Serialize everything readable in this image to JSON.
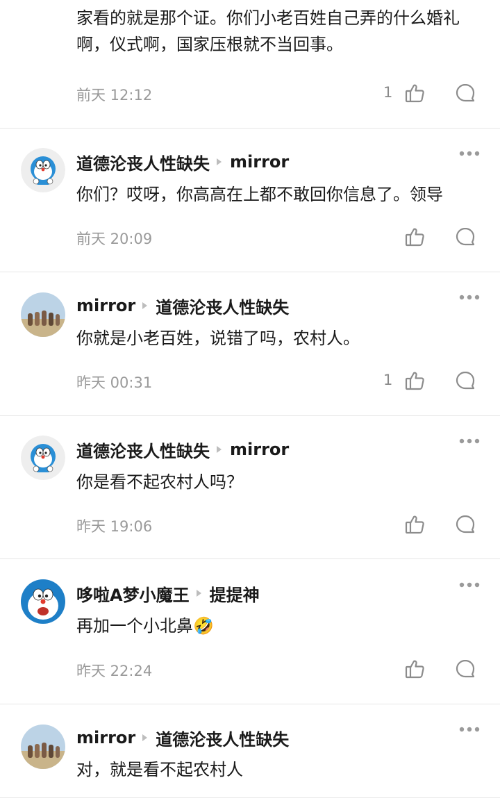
{
  "comments": [
    {
      "text": "家看的就是那个证。你们小老百姓自己弄的什么婚礼啊，仪式啊，国家压根就不当回事。",
      "time": "前天 12:12",
      "likes": "1"
    },
    {
      "author": "道德沦丧人性缺失",
      "reply_to": "mirror",
      "text": "你们？哎呀，你高高在上都不敢回你信息了。领导",
      "time": "前天 20:09",
      "likes": ""
    },
    {
      "author": "mirror",
      "reply_to": "道德沦丧人性缺失",
      "text": "你就是小老百姓，说错了吗，农村人。",
      "time": "昨天 00:31",
      "likes": "1"
    },
    {
      "author": "道德沦丧人性缺失",
      "reply_to": "mirror",
      "text": "你是看不起农村人吗？",
      "time": "昨天 19:06",
      "likes": ""
    },
    {
      "author": "哆啦A梦小魔王",
      "reply_to": "提提神",
      "text": "再加一个小北鼻",
      "emoji": "🤣",
      "time": "昨天 22:24",
      "likes": ""
    },
    {
      "author": "mirror",
      "reply_to": "道德沦丧人性缺失",
      "text": "对，就是看不起农村人"
    }
  ],
  "icons": {
    "like": "thumbs-up-icon",
    "reply": "comment-bubble-icon",
    "more": "more-dots-icon",
    "reply_arrow": "reply-arrow-icon"
  },
  "colors": {
    "text": "#1a1a1a",
    "muted": "#9a9a9a",
    "icon": "#8c8c8c",
    "divider": "#e6e6e6"
  }
}
